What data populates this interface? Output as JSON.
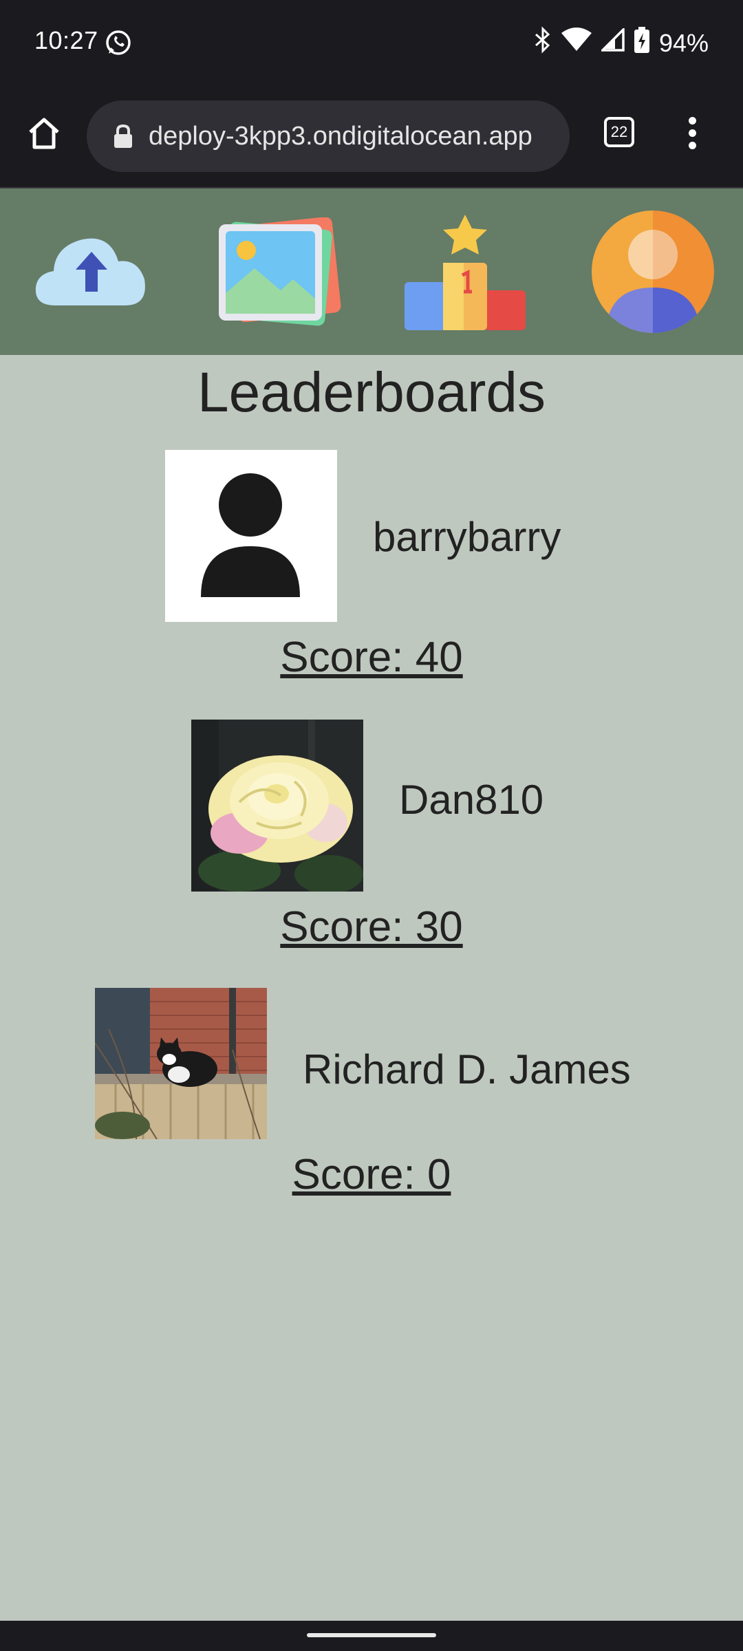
{
  "status_bar": {
    "time": "10:27",
    "battery": "94%",
    "icons": [
      "whatsapp-icon",
      "bluetooth-icon",
      "wifi-icon",
      "signal-icon",
      "battery-icon"
    ]
  },
  "browser": {
    "url": "deploy-3kpp3.ondigitalocean.app",
    "tab_count": "22"
  },
  "nav": {
    "items": [
      "upload-cloud-icon",
      "gallery-icon",
      "leaderboard-podium-icon",
      "profile-avatar-icon"
    ]
  },
  "page": {
    "title": "Leaderboards"
  },
  "leaderboard": [
    {
      "username": "barrybarry",
      "score": "Score: 40",
      "avatar": "default-user-silhouette"
    },
    {
      "username": "Dan810",
      "score": "Score: 30",
      "avatar": "rose-photo"
    },
    {
      "username": "Richard D. James",
      "score": "Score: 0",
      "avatar": "cat-on-fence-photo"
    }
  ],
  "colors": {
    "nav_bg": "#657c66",
    "page_bg": "#bfc8bf",
    "system_bar": "#1b1b1f"
  }
}
